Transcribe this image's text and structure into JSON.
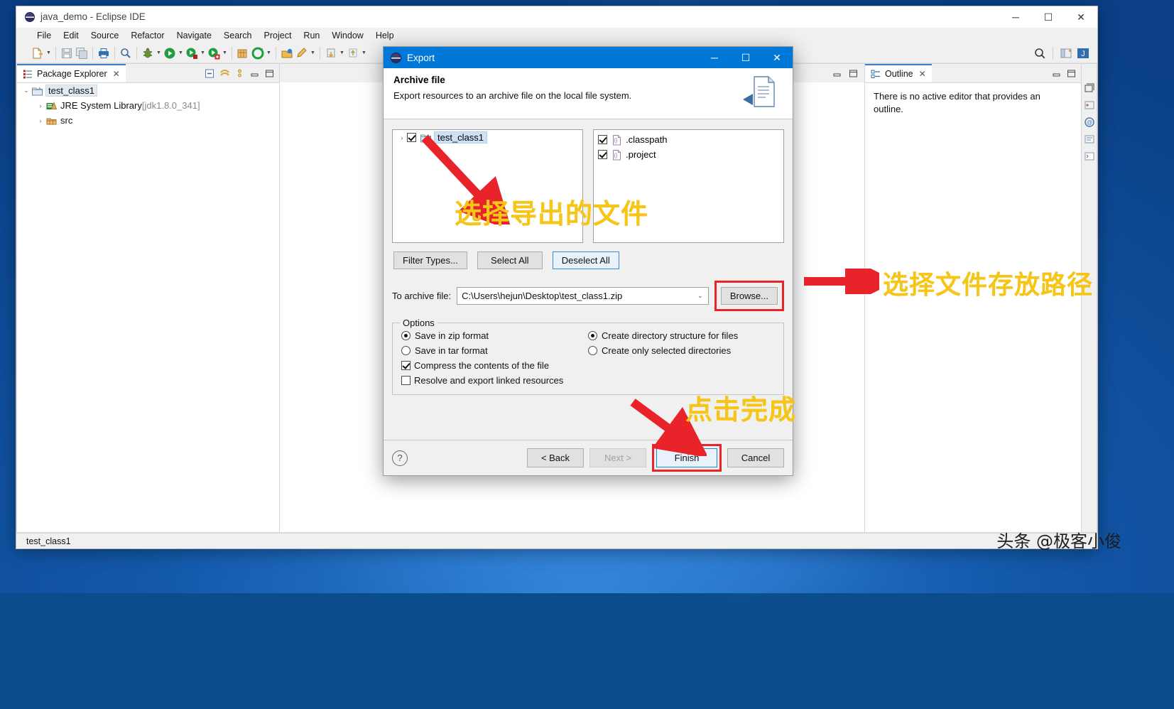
{
  "window": {
    "title": "java_demo - Eclipse IDE",
    "minimize": "─",
    "maximize": "☐",
    "close": "✕"
  },
  "menubar": [
    "File",
    "Edit",
    "Source",
    "Refactor",
    "Navigate",
    "Search",
    "Project",
    "Run",
    "Window",
    "Help"
  ],
  "package_explorer": {
    "tab_label": "Package Explorer",
    "close_glyph": "✕",
    "tree": [
      {
        "label": "test_class1",
        "twisty": "⌄",
        "selected": true,
        "indent": 0,
        "suffix": ""
      },
      {
        "label": "JRE System Library ",
        "twisty": "›",
        "selected": false,
        "indent": 1,
        "suffix": "[jdk1.8.0_341]"
      },
      {
        "label": "src",
        "twisty": "›",
        "selected": false,
        "indent": 1,
        "suffix": ""
      }
    ]
  },
  "outline": {
    "tab_label": "Outline",
    "close_glyph": "✕",
    "message": "There is no active editor that provides an outline."
  },
  "statusbar": {
    "text": "test_class1"
  },
  "dialog": {
    "title": "Export",
    "minimize": "─",
    "maximize": "☐",
    "close": "✕",
    "heading": "Archive file",
    "subheading": "Export resources to an archive file on the local file system.",
    "left_tree": [
      {
        "label": "test_class1",
        "checked": true,
        "selected": true,
        "twisty": "›"
      }
    ],
    "right_list": [
      {
        "label": ".classpath",
        "checked": true
      },
      {
        "label": ".project",
        "checked": true
      }
    ],
    "list_buttons": [
      {
        "label": "Filter Types...",
        "underline_index": 7,
        "focused": false
      },
      {
        "label": "Select All",
        "underline_index": 0,
        "focused": false
      },
      {
        "label": "Deselect All",
        "underline_index": 0,
        "focused": true
      }
    ],
    "archive": {
      "label": "To archive file:",
      "value": "C:\\Users\\hejun\\Desktop\\test_class1.zip",
      "dropdown_glyph": "⌄",
      "browse_label": "Browse..."
    },
    "options": {
      "legend": "Options",
      "left": [
        {
          "type": "radio",
          "label": "Save in zip format",
          "checked": true
        },
        {
          "type": "radio",
          "label": "Save in tar format",
          "checked": false
        },
        {
          "type": "check",
          "label": "Compress the contents of the file",
          "checked": true
        },
        {
          "type": "check",
          "label": "Resolve and export linked resources",
          "checked": false
        }
      ],
      "right": [
        {
          "type": "radio",
          "label": "Create directory structure for files",
          "checked": true
        },
        {
          "type": "radio",
          "label": "Create only selected directories",
          "checked": false
        }
      ]
    },
    "footer": {
      "help_glyph": "?",
      "back": "< Back",
      "next": "Next >",
      "finish": "Finish",
      "cancel": "Cancel"
    }
  },
  "annotations": {
    "select_files": "选择导出的文件",
    "select_path": "选择文件存放路径",
    "click_finish": "点击完成"
  },
  "watermark": {
    "text": "头条 @极客小俊"
  },
  "colors": {
    "accent_blue": "#0078d7",
    "annotation_red": "#e8232a",
    "annotation_yellow": "#f5c518",
    "tab_underline": "#3b7fc4"
  }
}
